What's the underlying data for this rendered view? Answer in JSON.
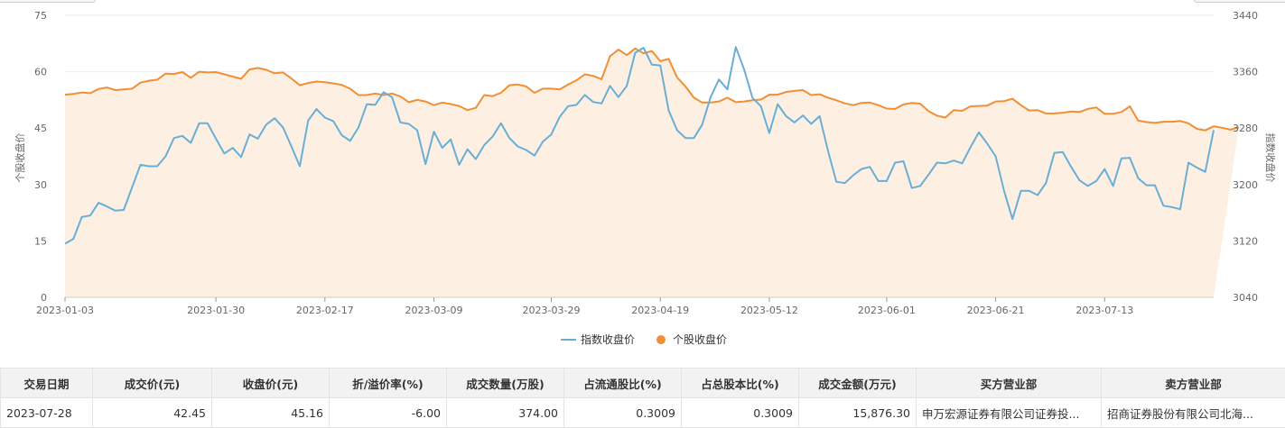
{
  "chart_data": {
    "type": "line",
    "left_axis_title": "个股收盘价",
    "right_axis_title": "指数收盘价",
    "left_ylim": [
      0,
      75
    ],
    "left_ticks": [
      "0",
      "15",
      "30",
      "45",
      "60",
      "75"
    ],
    "right_ylim": [
      3040,
      3440
    ],
    "right_ticks": [
      "3040",
      "3120",
      "3200",
      "3280",
      "3360",
      "3440"
    ],
    "x_tick_labels": [
      "2023-01-03",
      "2023-01-30",
      "2023-02-17",
      "2023-03-09",
      "2023-03-29",
      "2023-04-19",
      "2023-05-12",
      "2023-06-01",
      "2023-06-21",
      "2023-07-13"
    ],
    "x_tick_index": [
      0,
      18,
      31,
      44,
      58,
      71,
      84,
      98,
      111,
      124
    ],
    "legend": "bottom-center",
    "grid": true,
    "series": [
      {
        "name": "指数收盘价",
        "color": "#6aaed6",
        "axis": "right",
        "values": [
          3116,
          3123,
          3154,
          3156,
          3174,
          3169,
          3163,
          3164,
          3196,
          3228,
          3226,
          3226,
          3240,
          3266,
          3269,
          3259,
          3287,
          3287,
          3265,
          3244,
          3252,
          3239,
          3271,
          3265,
          3285,
          3294,
          3281,
          3254,
          3226,
          3291,
          3307,
          3295,
          3290,
          3270,
          3262,
          3281,
          3314,
          3313,
          3331,
          3324,
          3288,
          3286,
          3277,
          3229,
          3275,
          3252,
          3264,
          3228,
          3250,
          3236,
          3256,
          3268,
          3287,
          3266,
          3254,
          3249,
          3241,
          3261,
          3271,
          3296,
          3311,
          3313,
          3327,
          3317,
          3315,
          3340,
          3324,
          3340,
          3387,
          3394,
          3370,
          3369,
          3305,
          3277,
          3266,
          3266,
          3285,
          3324,
          3349,
          3335,
          3395,
          3363,
          3323,
          3311,
          3273,
          3314,
          3297,
          3288,
          3298,
          3286,
          3297,
          3248,
          3204,
          3202,
          3213,
          3222,
          3225,
          3205,
          3205,
          3231,
          3233,
          3195,
          3198,
          3214,
          3231,
          3230,
          3234,
          3230,
          3253,
          3274,
          3258,
          3240,
          3191,
          3151,
          3191,
          3191,
          3185,
          3202,
          3245,
          3246,
          3225,
          3206,
          3198,
          3205,
          3222,
          3198,
          3237,
          3238,
          3209,
          3199,
          3199,
          3170,
          3168,
          3165,
          3231,
          3224,
          3218,
          3277
        ]
      },
      {
        "name": "个股收盘价",
        "color": "#f08f34",
        "axis": "left",
        "values": [
          53.9,
          54.1,
          54.5,
          54.3,
          55.4,
          55.8,
          55.1,
          55.3,
          55.5,
          57.1,
          57.6,
          57.9,
          59.5,
          59.4,
          59.9,
          58.4,
          60.0,
          59.8,
          59.9,
          59.3,
          58.7,
          58.1,
          60.6,
          61.0,
          60.5,
          59.6,
          59.8,
          58.2,
          56.4,
          57.0,
          57.4,
          57.2,
          56.9,
          56.5,
          55.5,
          53.8,
          53.8,
          54.2,
          53.8,
          54.2,
          53.4,
          51.9,
          52.5,
          52.1,
          51.1,
          51.8,
          51.4,
          50.9,
          49.8,
          50.4,
          53.8,
          53.5,
          54.4,
          56.4,
          56.6,
          56.1,
          54.4,
          55.5,
          55.5,
          55.3,
          56.6,
          57.7,
          59.3,
          58.9,
          58.0,
          64.1,
          65.9,
          64.4,
          66.2,
          64.9,
          65.5,
          62.8,
          63.4,
          58.5,
          56.1,
          53.1,
          51.8,
          51.8,
          52.1,
          53.1,
          51.9,
          52.1,
          52.4,
          52.6,
          53.9,
          53.9,
          54.6,
          54.9,
          55.1,
          53.8,
          54.0,
          53.1,
          52.4,
          51.6,
          51.1,
          51.7,
          51.8,
          51.1,
          50.2,
          50.1,
          51.3,
          51.7,
          51.5,
          49.5,
          48.3,
          47.8,
          49.8,
          49.6,
          50.8,
          50.9,
          51.0,
          52.1,
          52.2,
          52.8,
          51.1,
          49.7,
          49.8,
          48.9,
          48.9,
          49.1,
          49.4,
          49.3,
          50.1,
          50.5,
          48.8,
          48.8,
          49.3,
          50.8,
          47.0,
          46.6,
          46.4,
          46.7,
          46.7,
          46.9,
          46.3,
          44.8,
          44.4,
          45.5,
          45.1,
          44.6,
          45.2
        ]
      }
    ]
  },
  "table": {
    "headers": [
      "交易日期",
      "成交价(元)",
      "收盘价(元)",
      "折/溢价率(%)",
      "成交数量(万股)",
      "占流通股比(%)",
      "占总股本比(%)",
      "成交金额(万元)",
      "买方营业部",
      "卖方营业部"
    ],
    "rows": [
      [
        "2023-07-28",
        "42.45",
        "45.16",
        "-6.00",
        "374.00",
        "0.3009",
        "0.3009",
        "15,876.30",
        "申万宏源证券有限公司证券投...",
        "招商证券股份有限公司北海..."
      ]
    ]
  }
}
